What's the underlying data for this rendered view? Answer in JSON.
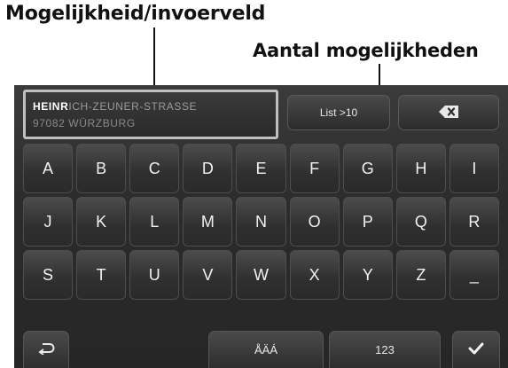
{
  "callouts": {
    "field_label": "Mogelijkheid/invoerveld",
    "count_label": "Aantal mogelijkheden"
  },
  "input": {
    "typed": "HEINR",
    "completion": "ICH-ZEUNER-STRASSE",
    "city": "97082 WÜRZBURG"
  },
  "toolbar": {
    "list_label": "List >10",
    "backspace_icon": "backspace-icon"
  },
  "keyboard": {
    "keys": [
      "A",
      "B",
      "C",
      "D",
      "E",
      "F",
      "G",
      "H",
      "I",
      "J",
      "K",
      "L",
      "M",
      "N",
      "O",
      "P",
      "Q",
      "R",
      "S",
      "T",
      "U",
      "V",
      "W",
      "X",
      "Y",
      "Z",
      "_"
    ]
  },
  "bottom_bar": {
    "back_icon": "return-icon",
    "accents_label": "ÅÄÁ",
    "numbers_label": "123",
    "confirm_icon": "checkmark-icon"
  }
}
